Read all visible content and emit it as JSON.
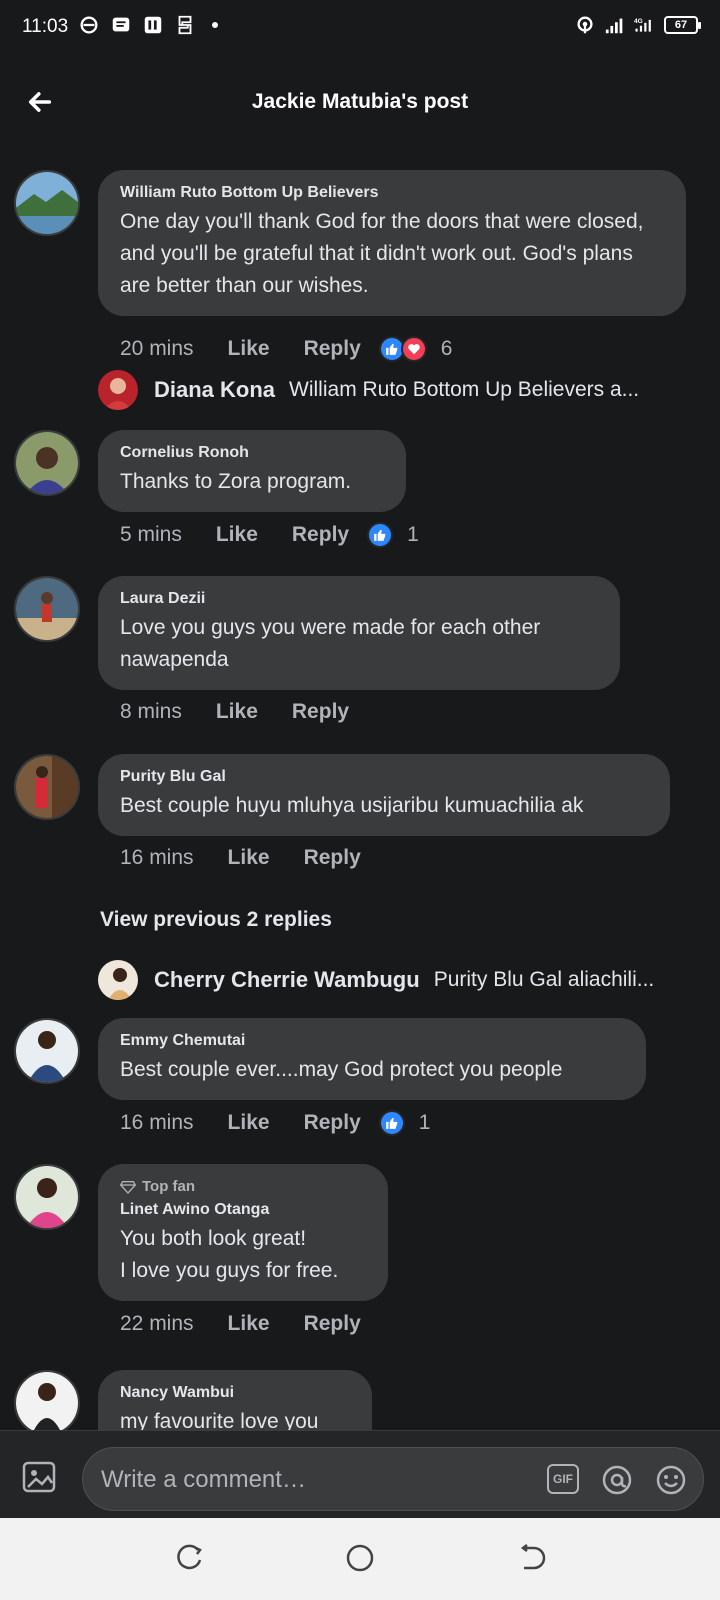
{
  "status_bar": {
    "time": "11:03",
    "battery": "67",
    "network": "4G"
  },
  "header": {
    "title": "Jackie Matubia's post"
  },
  "comments": [
    {
      "name": "William Ruto Bottom Up Believers",
      "text": "One day you'll thank God for the doors that were closed, and you'll be grateful that it didn't work out. God's plans are better than our wishes.",
      "time": "20 mins",
      "like": "Like",
      "reply": "Reply",
      "reactions": [
        "like",
        "love"
      ],
      "reaction_count": "6"
    },
    {
      "name": "Cornelius Ronoh",
      "text": "Thanks to Zora program.",
      "time": "5 mins",
      "like": "Like",
      "reply": "Reply",
      "reactions": [
        "like"
      ],
      "reaction_count": "1"
    },
    {
      "name": "Laura Dezii",
      "text": "Love you guys you were made for each other\nnawapenda",
      "time": "8 mins",
      "like": "Like",
      "reply": "Reply"
    },
    {
      "name": "Purity Blu Gal",
      "text": "Best couple huyu mluhya usijaribu kumuachilia ak",
      "time": "16 mins",
      "like": "Like",
      "reply": "Reply"
    },
    {
      "name": "Emmy Chemutai",
      "text": "Best couple ever....may God protect you people",
      "time": "16 mins",
      "like": "Like",
      "reply": "Reply",
      "reactions": [
        "like"
      ],
      "reaction_count": "1"
    },
    {
      "badge": "Top fan",
      "name": "Linet Awino Otanga",
      "text": "You both look great!\nI love you guys for free.",
      "time": "22 mins",
      "like": "Like",
      "reply": "Reply"
    },
    {
      "name": "Nancy Wambui",
      "text": "my favourite love you"
    }
  ],
  "reply_previews": [
    {
      "name": "Diana Kona",
      "text": "William Ruto Bottom Up Believers a..."
    },
    {
      "name": "Cherry Cherrie Wambugu",
      "text": "Purity Blu Gal aliachili..."
    }
  ],
  "view_previous": "View previous 2 replies",
  "composer": {
    "placeholder": "Write a comment…",
    "gif_label": "GIF"
  },
  "colors": {
    "background": "#18191a",
    "bubble": "#3a3b3c",
    "like_blue": "#2d88ff",
    "love_red": "#f33e58"
  }
}
